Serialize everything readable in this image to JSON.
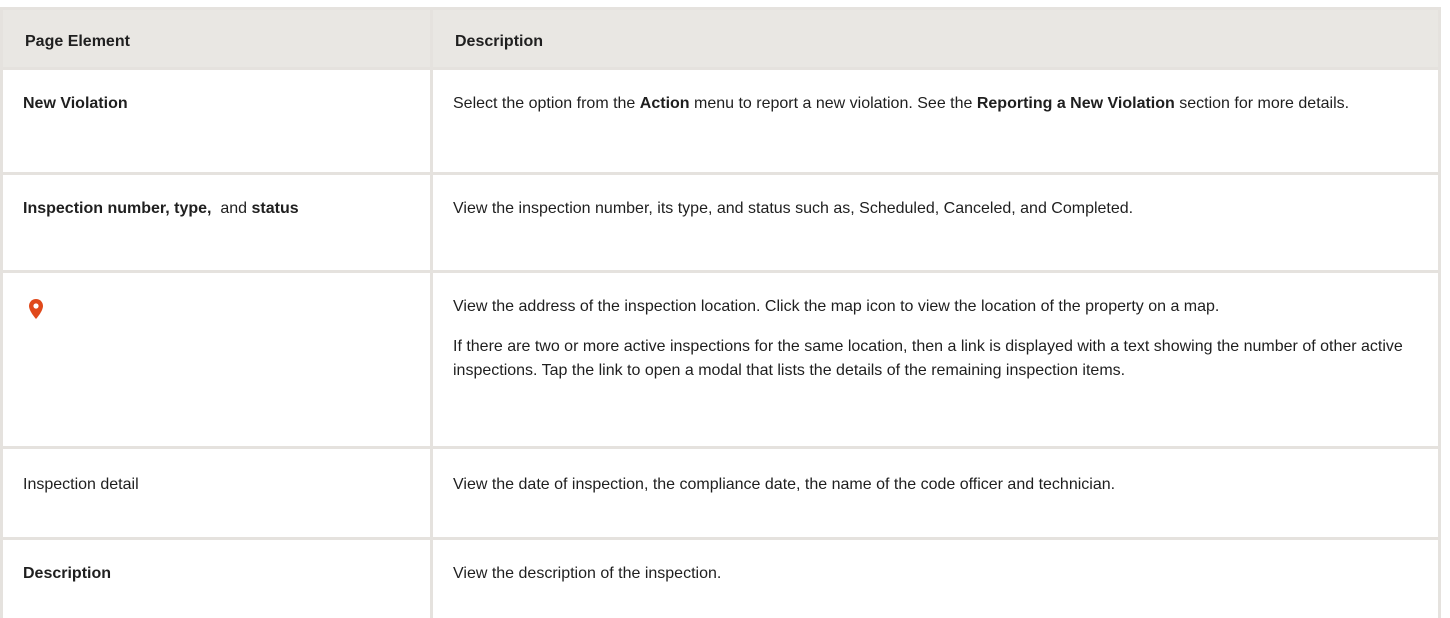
{
  "header": {
    "col1": "Page Element",
    "col2": "Description"
  },
  "rows": {
    "new_violation": {
      "element": "New Violation",
      "desc_pre": "Select the option from the ",
      "desc_bold1": "Action",
      "desc_mid": " menu to report a new violation. See the ",
      "desc_bold2": "Reporting a New Violation",
      "desc_post": " section for more details."
    },
    "inspection_number": {
      "el_bold1": "Inspection number, type,",
      "el_mid": "  and ",
      "el_bold2": "status",
      "desc": "View the inspection number, its type, and status such as, Scheduled, Canceled, and Completed."
    },
    "map": {
      "icon": "map-pin-icon",
      "icon_color": "#e0491b",
      "desc_p1": "View the address of the inspection location. Click the map icon to view the location of the property on a map.",
      "desc_p2": "If there are two or more active inspections for the same location, then a link is displayed with a text showing the number of other active inspections. Tap the link to open a modal that lists the details of the remaining inspection items."
    },
    "inspection_detail": {
      "element": "Inspection detail",
      "desc": "View the date of inspection, the compliance date, the name of the code officer and technician."
    },
    "description": {
      "element": "Description",
      "desc": "View the description of the inspection."
    }
  }
}
